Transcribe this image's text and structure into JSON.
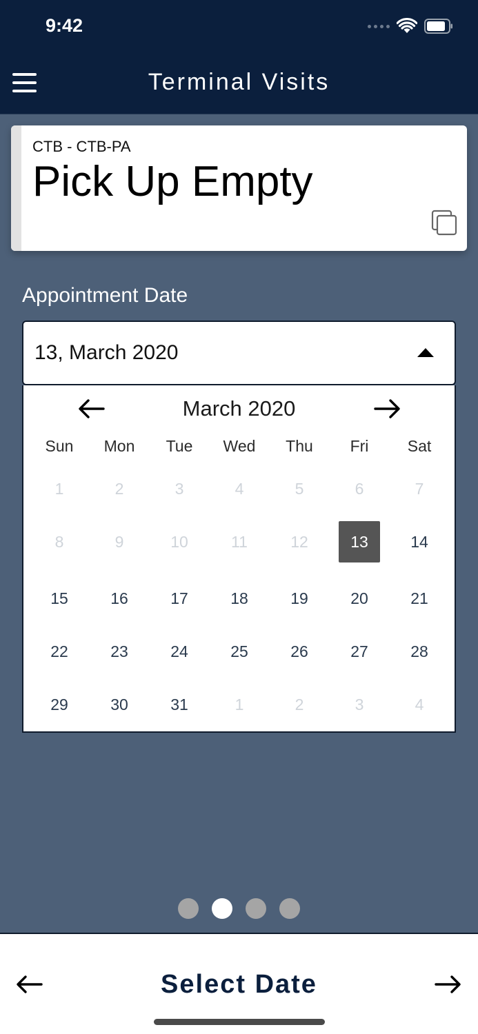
{
  "status_bar": {
    "time": "9:42"
  },
  "header": {
    "title": "Terminal Visits"
  },
  "visit": {
    "subtitle": "CTB - CTB-PA",
    "title": "Pick Up Empty"
  },
  "appointment": {
    "label": "Appointment Date",
    "selected_value": "13, March 2020"
  },
  "calendar": {
    "month_label": "March 2020",
    "weekdays": [
      "Sun",
      "Mon",
      "Tue",
      "Wed",
      "Thu",
      "Fri",
      "Sat"
    ],
    "weeks": [
      [
        {
          "d": "1",
          "m": true
        },
        {
          "d": "2",
          "m": true
        },
        {
          "d": "3",
          "m": true
        },
        {
          "d": "4",
          "m": true
        },
        {
          "d": "5",
          "m": true
        },
        {
          "d": "6",
          "m": true
        },
        {
          "d": "7",
          "m": true
        }
      ],
      [
        {
          "d": "8",
          "m": true
        },
        {
          "d": "9",
          "m": true
        },
        {
          "d": "10",
          "m": true
        },
        {
          "d": "11",
          "m": true
        },
        {
          "d": "12",
          "m": true
        },
        {
          "d": "13",
          "s": true
        },
        {
          "d": "14"
        }
      ],
      [
        {
          "d": "15"
        },
        {
          "d": "16"
        },
        {
          "d": "17"
        },
        {
          "d": "18"
        },
        {
          "d": "19"
        },
        {
          "d": "20"
        },
        {
          "d": "21"
        }
      ],
      [
        {
          "d": "22"
        },
        {
          "d": "23"
        },
        {
          "d": "24"
        },
        {
          "d": "25"
        },
        {
          "d": "26"
        },
        {
          "d": "27"
        },
        {
          "d": "28"
        }
      ],
      [
        {
          "d": "29"
        },
        {
          "d": "30"
        },
        {
          "d": "31"
        },
        {
          "d": "1",
          "m": true
        },
        {
          "d": "2",
          "m": true
        },
        {
          "d": "3",
          "m": true
        },
        {
          "d": "4",
          "m": true
        }
      ]
    ]
  },
  "pager": {
    "count": 4,
    "active_index": 1
  },
  "bottom_bar": {
    "title": "Select Date"
  },
  "colors": {
    "header_bg": "#0b1f3d",
    "page_bg": "#4d6078",
    "selected_day": "#555555",
    "muted_day": "#cfd4da"
  },
  "icons": {
    "menu": "hamburger-icon",
    "copy": "copy-icon",
    "prev_month": "arrow-left-icon",
    "next_month": "arrow-right-icon",
    "dropdown": "caret-up-icon"
  }
}
